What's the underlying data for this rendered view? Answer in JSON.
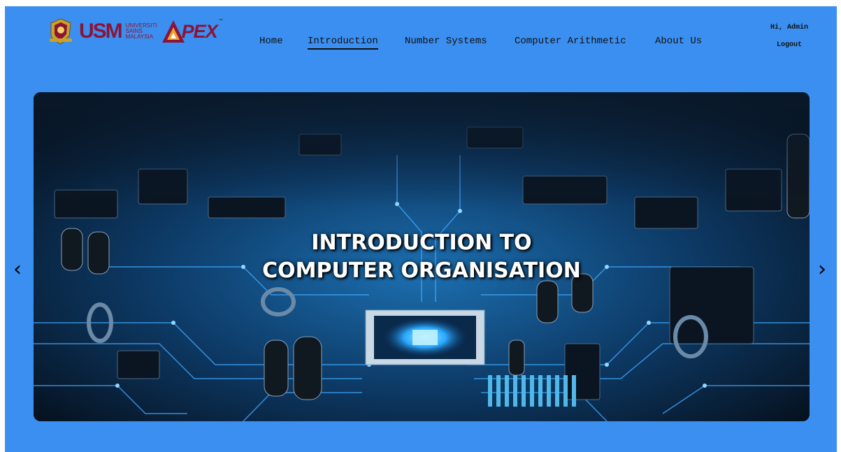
{
  "header": {
    "logo_usm": {
      "word": "USM",
      "sub_lines": [
        "UNIVERSITI",
        "SAINS",
        "MALAYSIA"
      ]
    },
    "logo_apex": {
      "word": "PEX",
      "tm": "™"
    },
    "nav": [
      {
        "label": "Home",
        "active": false
      },
      {
        "label": "Introduction",
        "active": true
      },
      {
        "label": "Number Systems",
        "active": false
      },
      {
        "label": "Computer Arithmetic",
        "active": false
      },
      {
        "label": "About Us",
        "active": false
      }
    ],
    "user": {
      "greeting": "Hi, Admin",
      "logout": "Logout"
    }
  },
  "carousel": {
    "caption_line1": "INTRODUCTION TO",
    "caption_line2": "COMPUTER ORGANISATION",
    "prev_icon": "‹",
    "next_icon": "›"
  },
  "colors": {
    "page_bg": "#3b8ff0",
    "brand": "#8a1538",
    "text": "#111111"
  }
}
